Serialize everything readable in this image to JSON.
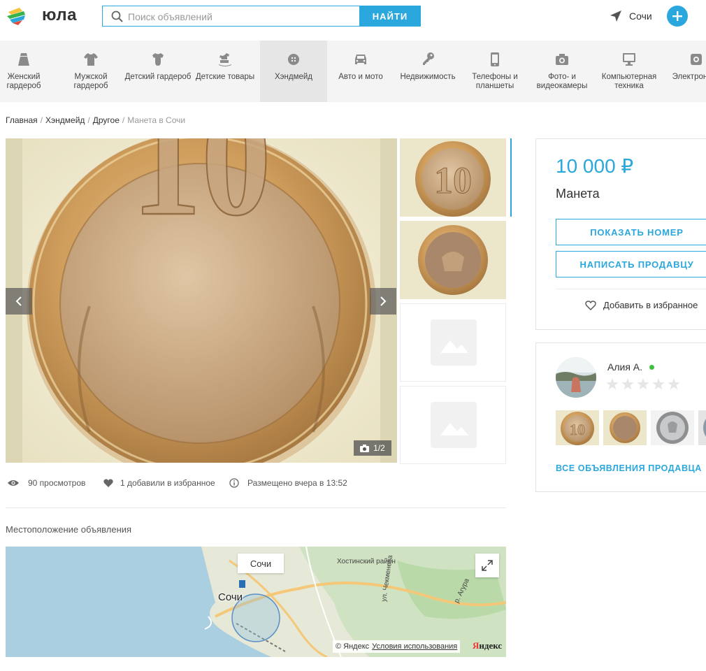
{
  "header": {
    "brand": "юла",
    "search_placeholder": "Поиск объявлений",
    "search_button": "НАЙТИ",
    "city": "Сочи",
    "colors": {
      "accent": "#2aa7dc",
      "online": "#3fbf3f"
    }
  },
  "categories": [
    {
      "icon": "skirt-icon",
      "label": "Женский гардероб"
    },
    {
      "icon": "tshirt-icon",
      "label": "Мужской гардероб"
    },
    {
      "icon": "baby-bodysuit-icon",
      "label": "Детский гардероб"
    },
    {
      "icon": "rocking-horse-icon",
      "label": "Детские товары"
    },
    {
      "icon": "button-icon",
      "label": "Хэндмейд",
      "active": true
    },
    {
      "icon": "car-icon",
      "label": "Авто и мото"
    },
    {
      "icon": "key-icon",
      "label": "Недвижимость"
    },
    {
      "icon": "phone-icon",
      "label": "Телефоны и планшеты"
    },
    {
      "icon": "camera-icon",
      "label": "Фото- и видеокамеры"
    },
    {
      "icon": "monitor-icon",
      "label": "Компьютерная техника"
    },
    {
      "icon": "electronics-icon",
      "label": "Электроника"
    }
  ],
  "breadcrumb": {
    "items": [
      "Главная",
      "Хэндмейд",
      "Другое"
    ],
    "current": "Манета в Сочи"
  },
  "gallery": {
    "counter": "1/2"
  },
  "stats": {
    "views": "90 просмотров",
    "favorites": "1 добавили в избранное",
    "posted": "Размещено вчера в 13:52"
  },
  "location": {
    "title": "Местоположение объявления",
    "map_label": "Сочи",
    "city_text": "Сочи",
    "district": "Хостинский район",
    "street_1": "ул. Чекменева",
    "street_2": "р. Агура",
    "copyright": "© Яндекс",
    "terms": "Условия использования",
    "yandex_logo": "Яндекс"
  },
  "listing": {
    "price": "10 000 ₽",
    "title": "Манета",
    "show_number": "ПОКАЗАТЬ НОМЕР",
    "message_seller": "НАПИСАТЬ ПРОДАВЦУ",
    "add_favorite": "Добавить в избранное"
  },
  "seller": {
    "name": "Алия А.",
    "rating": 0,
    "rating_max": 5,
    "all_listings": "ВСЕ ОБЪЯВЛЕНИЯ ПРОДАВЦА"
  }
}
